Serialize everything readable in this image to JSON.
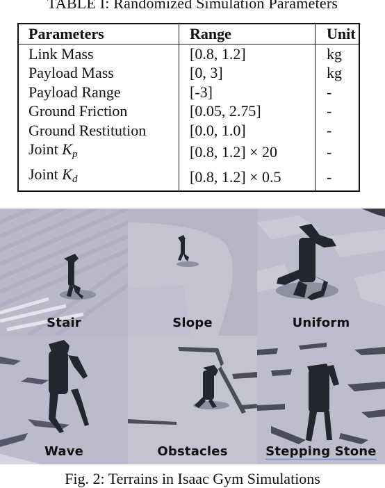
{
  "table": {
    "caption": "TABLE I: Randomized Simulation Parameters",
    "headers": [
      "Parameters",
      "Range",
      "Unit"
    ],
    "rows": [
      {
        "parameter": "Link Mass",
        "range": "[0.8, 1.2]",
        "unit": "kg"
      },
      {
        "parameter": "Payload Mass",
        "range": "[0, 3]",
        "unit": "kg"
      },
      {
        "parameter": "Payload Range",
        "range": "[-3]",
        "unit": "-"
      },
      {
        "parameter": "Ground Friction",
        "range": "[0.05, 2.75]",
        "unit": "-"
      },
      {
        "parameter": "Ground Restitution",
        "range": "[0.0, 1.0]",
        "unit": "-"
      },
      {
        "parameter_prefix": "Joint ",
        "parameter_symbol": "K",
        "parameter_subscript": "p",
        "range": "[0.8, 1.2] × 20",
        "unit": "-"
      },
      {
        "parameter_prefix": "Joint ",
        "parameter_symbol": "K",
        "parameter_subscript": "d",
        "range": "[0.8, 1.2] × 0.5",
        "unit": "-"
      }
    ]
  },
  "figure": {
    "panels": [
      {
        "label": "Stair",
        "scene": "stair terrain with robot"
      },
      {
        "label": "Slope",
        "scene": "slope terrain with robot"
      },
      {
        "label": "Uniform",
        "scene": "uniform rough terrain with robot"
      },
      {
        "label": "Wave",
        "scene": "wave terrain with robot"
      },
      {
        "label": "Obstacles",
        "scene": "obstacles terrain with robot"
      },
      {
        "label": "Stepping Stone",
        "scene": "stepping stone terrain with robot"
      }
    ],
    "caption": "Fig. 2: Terrains in Isaac Gym Simulations"
  },
  "colors": {
    "terrain": "#b7b7c8",
    "terrain_light": "#d2d2de",
    "robot": "#23262f",
    "label_underline": "#4a7fd0"
  }
}
